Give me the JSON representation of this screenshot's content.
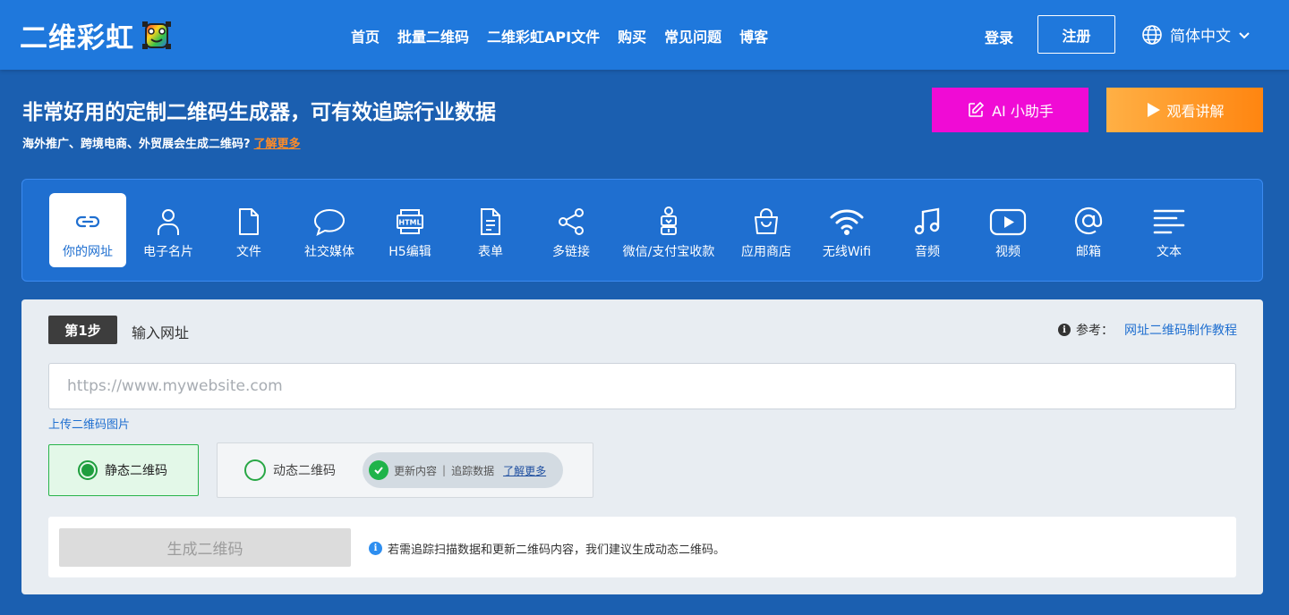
{
  "nav": {
    "logo_text": "二维彩虹",
    "links": [
      "首页",
      "批量二维码",
      "二维彩虹API文件",
      "购买",
      "常见问题",
      "博客"
    ],
    "login": "登录",
    "register": "注册",
    "language": "简体中文"
  },
  "hero": {
    "title": "非常好用的定制二维码生成器，可有效追踪行业数据",
    "subtitle": "海外推广、跨境电商、外贸展会生成二维码?",
    "learn_more": "了解更多",
    "ai_button": "AI 小助手",
    "video_button": "观看讲解"
  },
  "types": [
    {
      "label": "你的网址",
      "icon": "link-icon",
      "active": true
    },
    {
      "label": "电子名片",
      "icon": "person-icon"
    },
    {
      "label": "文件",
      "icon": "file-icon"
    },
    {
      "label": "社交媒体",
      "icon": "chat-bubble-icon"
    },
    {
      "label": "H5编辑",
      "icon": "html-icon"
    },
    {
      "label": "表单",
      "icon": "form-icon"
    },
    {
      "label": "多链接",
      "icon": "share-icon"
    },
    {
      "label": "微信/支付宝收款",
      "icon": "payment-icon"
    },
    {
      "label": "应用商店",
      "icon": "shopping-bag-icon"
    },
    {
      "label": "无线Wifi",
      "icon": "wifi-icon"
    },
    {
      "label": "音频",
      "icon": "music-icon"
    },
    {
      "label": "视频",
      "icon": "play-icon"
    },
    {
      "label": "邮箱",
      "icon": "at-icon"
    },
    {
      "label": "文本",
      "icon": "text-lines-icon"
    }
  ],
  "form": {
    "step_badge": "第1步",
    "step_title": "输入网址",
    "ref_label": "参考：",
    "ref_link": "网址二维码制作教程",
    "url_placeholder": "https://www.mywebsite.com",
    "url_value": "",
    "upload_link": "上传二维码图片",
    "static_label": "静态二维码",
    "dynamic_label": "动态二维码",
    "feature_update": "更新内容",
    "feature_sep": "|",
    "feature_track": "追踪数据",
    "feature_more": "了解更多",
    "generate_button": "生成二维码",
    "generate_note": "若需追踪扫描数据和更新二维码内容，我们建议生成动态二维码。"
  },
  "colors": {
    "nav_bg": "#1f78dc",
    "page_bg": "#1b5fb0",
    "ai_button": "#f00bd5",
    "video_button": "#ff8510",
    "accent_orange": "#ff8c28",
    "selected_green": "#1e9e3e"
  }
}
